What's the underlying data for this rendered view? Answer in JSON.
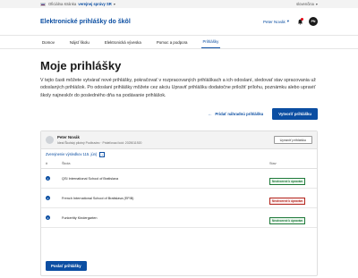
{
  "gov_bar": {
    "prefix": "Oficiálna stránka",
    "link": "verejnej správy SR",
    "chevron": "▾",
    "language": "slovenčina",
    "lang_chevron": "▾"
  },
  "header": {
    "title": "Elektronické prihlášky do škôl",
    "user": "Peter Novák",
    "user_chevron": "▾",
    "avatar_initials": "PN"
  },
  "nav": {
    "items": [
      {
        "label": "Domov"
      },
      {
        "label": "Nájsť školu"
      },
      {
        "label": "Elektronická výveska"
      },
      {
        "label": "Pomoc a podpora"
      },
      {
        "label": "Prihlášky"
      }
    ]
  },
  "main": {
    "title": "Moje prihlášky",
    "intro": "V tejto časti môžete vytvárať nové prihlášky, pokračovať v rozpracovaných prihláškach a ich odoslaní, sledovať stav spracovania už odoslaných prihlášok. Po odoslaní prihlášky môžete cez akciu Upraviť prihlášku dodatočne priložiť prílohu, poznámku alebo upraviť školy najneskôr do posledného dňa na podávanie prihlášok.",
    "link_action": "Pridať náhradnú prihlášku",
    "link_arrow": "←",
    "primary_action": "Vytvoriť prihlášku"
  },
  "application": {
    "name": "Peter Novák",
    "meta": "Ideal Školský pilotný Podbuviec  ·  Prideľovací kód: 2025011920",
    "edit_button": "Upraviť prihlášku",
    "results_label": "Zverejnenie výsledkov 115. jún)",
    "results_chevron": "⌄",
    "columns": {
      "number": "#",
      "school": "Škola",
      "status": "Stav"
    },
    "rows": [
      {
        "num": "1",
        "school": "QSI International School of Bratislava",
        "status": "Neotvorené k úpravám",
        "kind": "ok"
      },
      {
        "num": "2",
        "school": "French International School of Bratislava (EFIB)",
        "status": "Neotvorené k úpravám",
        "kind": "no"
      },
      {
        "num": "3",
        "school": "Funkertity Kindergarten",
        "status": "Neotvorené k úpravám",
        "kind": "ok"
      }
    ],
    "send_button": "Poslať prihlášky"
  },
  "colors": {
    "brand": "#0b4ea2",
    "success": "#1f7a3a",
    "danger": "#b3261e"
  }
}
